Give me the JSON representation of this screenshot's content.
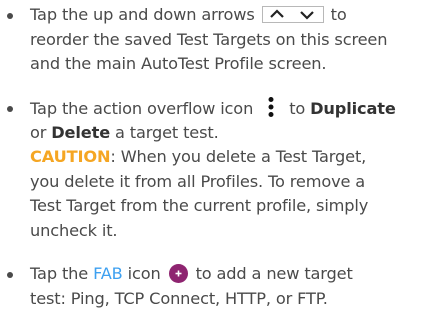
{
  "items": [
    {
      "lines": [
        {
          "a": "Tap the up and down arrows",
          "b": "to"
        },
        {
          "a": "reorder the saved Test Targets on this screen"
        },
        {
          "a": "and the main AutoTest Profile screen."
        }
      ]
    },
    {
      "lines": [
        {
          "a": "Tap the action overflow icon",
          "b": "to",
          "c": "Duplicate"
        },
        {
          "a": "or",
          "b": "Delete",
          "c": "a target test."
        },
        {
          "caution": "CAUTION",
          "a": ": When you delete a Test Target,"
        },
        {
          "a": "you delete it from all Profiles. To remove a"
        },
        {
          "a": "Test Target from the current profile, simply"
        },
        {
          "a": "uncheck it."
        }
      ]
    },
    {
      "lines": [
        {
          "a": "Tap the",
          "link": "FAB",
          "b": "icon",
          "c": "to add a new target"
        },
        {
          "a": "test: Ping, TCP Connect, HTTP, or FTP."
        }
      ]
    }
  ],
  "icons": {
    "reorder": "up-down-arrows-icon",
    "overflow": "vertical-dots-icon",
    "fab": "fab-plus-icon"
  },
  "colors": {
    "text": "#4a4a4a",
    "caution": "#f5a623",
    "link": "#3da0f0",
    "fab": "#8e2470"
  }
}
